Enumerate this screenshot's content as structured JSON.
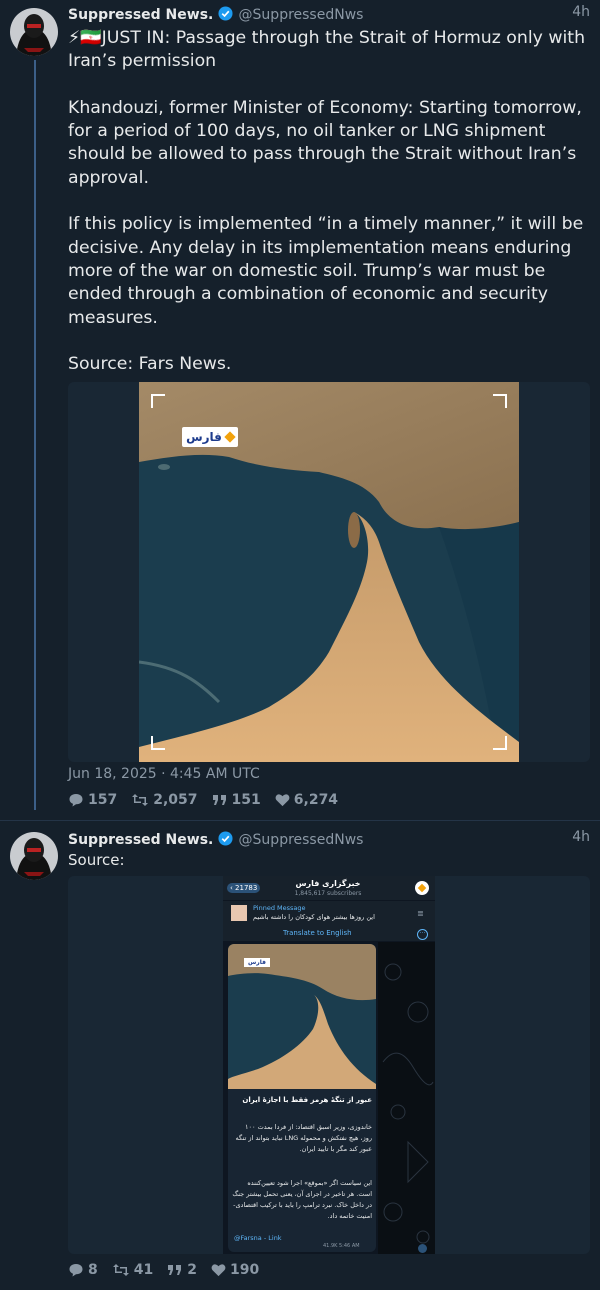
{
  "post1": {
    "author": "Suppressed News.",
    "handle": "@SuppressedNws",
    "time": "4h",
    "text": "⚡🇮🇷JUST IN: Passage through the Strait of Hormuz only with Iran’s permission\n\nKhandouzi, former Minister of Economy: Starting tomorrow, for a period of 100 days, no oil tanker or LNG shipment should be allowed to pass through the Strait without Iran’s approval.\n\nIf this policy is implemented “in a timely manner,” it will be decisive. Any delay in its implementation means enduring more of the war on domestic soil. Trump’s war must be ended through a combination of economic and security measures.\n\nSource: Fars News.",
    "image_logo": "فارس",
    "date": "Jun 18, 2025 · 4:45 AM UTC",
    "stats": {
      "replies": "157",
      "retweets": "2,057",
      "quotes": "151",
      "likes": "6,274"
    }
  },
  "post2": {
    "author": "Suppressed News.",
    "handle": "@SuppressedNws",
    "time": "4h",
    "text": "Source:",
    "telegram": {
      "back_count": "21783",
      "channel": "خبرگزاری فارس",
      "subscribers": "1,845,617 subscribers",
      "pinned_title": "Pinned Message",
      "pinned_text": "این روزها بیشتر هوای کودکان را داشته باشیم",
      "translate": "Translate to English",
      "logo": "فارس",
      "headline": "عبور از تنگهٔ هرمز فقط با اجازهٔ ایران",
      "para1": "خاندوزی، وزیر اسبق اقتصاد: از فردا بمدت ۱۰۰ روز، هیچ نفتکش و محموله LNG نباید بتواند از تنگه عبور کند مگر با تایید ایران.",
      "para2": "این سیاست اگر «بموقع» اجرا شود تعیین‌کننده است. هر تاخیر در اجرای آن، یعنی تحمل بیشتر جنگ در داخل خاک. نبرد ترامپ را باید با ترکیب اقتصادی-امنیت خاتمه داد.",
      "link": "@Farsna - Link",
      "meta": "41.9K 5:46 AM"
    },
    "stats": {
      "replies": "8",
      "retweets": "41",
      "quotes": "2",
      "likes": "190"
    }
  },
  "colors": {
    "background": "#15202b",
    "accent": "#1d9bf0",
    "muted": "#8b98a5",
    "thread": "#3c5f88"
  }
}
